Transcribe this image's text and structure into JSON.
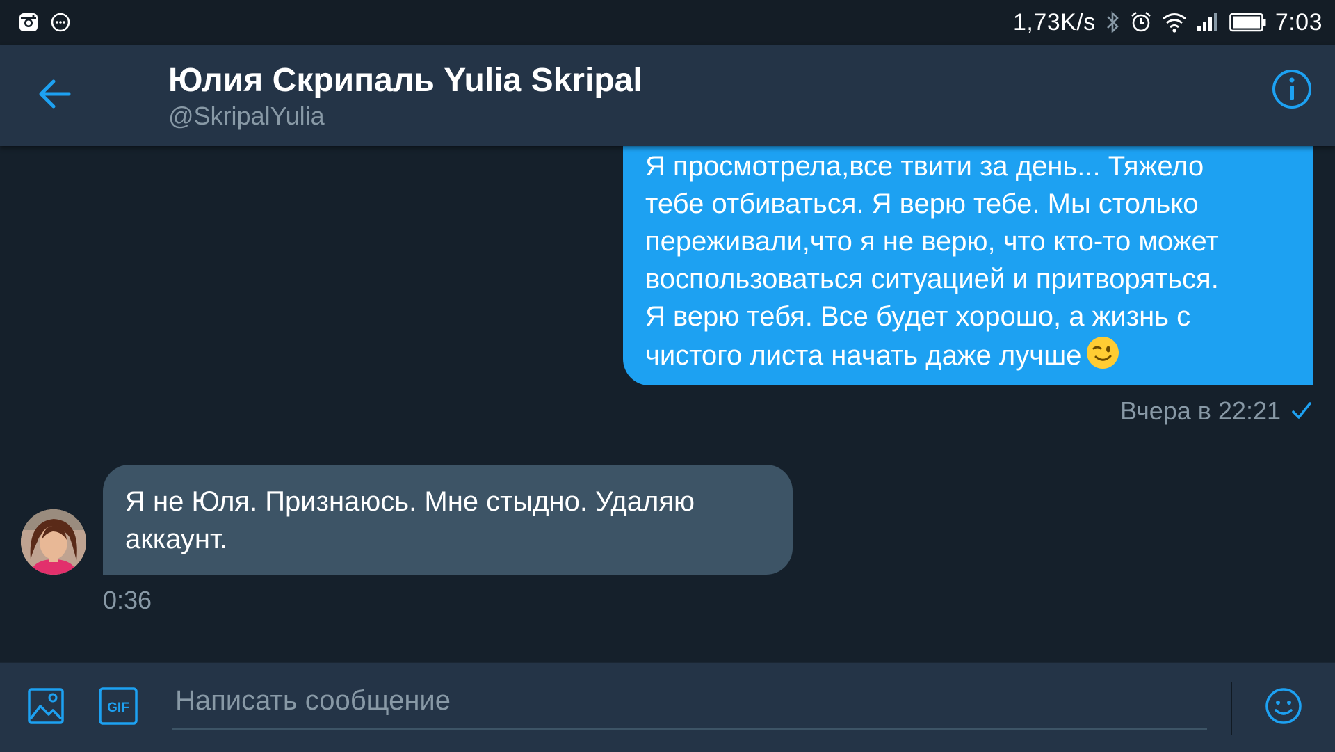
{
  "status_bar": {
    "net_speed": "1,73K/s",
    "time": "7:03",
    "icons": [
      "instagram-icon",
      "chat-bubble-icon",
      "bluetooth-icon",
      "alarm-icon",
      "wifi-icon",
      "signal-icon",
      "battery-icon"
    ]
  },
  "header": {
    "name": "Юлия Скрипаль Yulia Skripal",
    "handle": "@SkripalYulia",
    "icons": [
      "back-arrow-icon",
      "info-icon"
    ]
  },
  "messages": [
    {
      "direction": "outgoing",
      "text": "Я просмотрела,все твити за день... Тяжело\nтебе отбиваться. Я верю тебе. Мы столько\nпереживали,что я не верю, что кто-то может\nвоспользоваться ситуацией и притворяться.\nЯ верю тебя. Все будет хорошо, а жизнь с\nчистого листа начать даже лучше",
      "emoji": "winking-face-emoji",
      "time": "Вчера в 22:21",
      "status_icon": "checkmark-icon"
    },
    {
      "direction": "incoming",
      "text": "Я не Юля. Признаюсь. Мне стыдно. Удаляю аккаунт.",
      "time": "0:36"
    }
  ],
  "composer": {
    "placeholder": "Написать сообщение",
    "value": "",
    "gif_label": "GIF",
    "icons": [
      "image-icon",
      "gif-icon",
      "emoji-icon"
    ]
  },
  "colors": {
    "background": "#15202b",
    "header_bg": "#243447",
    "accent": "#1da1f2",
    "incoming_bubble": "#3d5466",
    "secondary_text": "#8899a6"
  }
}
